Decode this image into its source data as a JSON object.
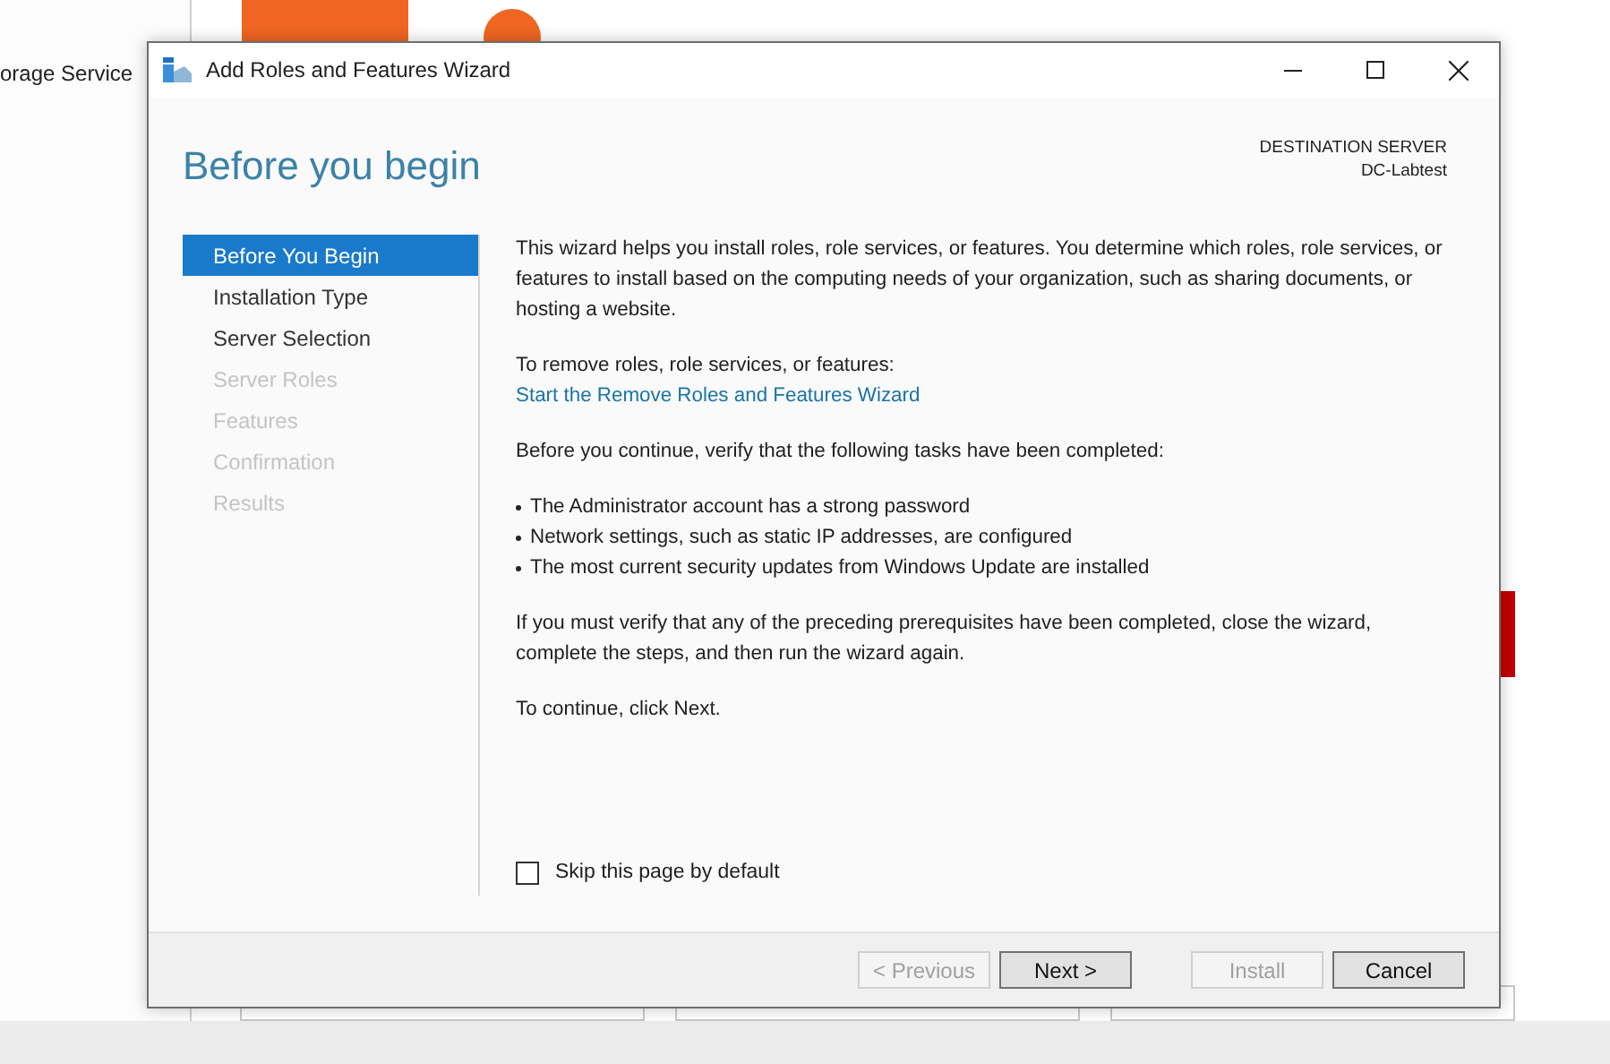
{
  "background": {
    "sidebar_item": "orage Service"
  },
  "window": {
    "title": "Add Roles and Features Wizard"
  },
  "header": {
    "title": "Before you begin",
    "destination_label": "DESTINATION SERVER",
    "destination_server": "DC-Labtest"
  },
  "steps": [
    {
      "label": "Before You Begin",
      "selected": true,
      "disabled": false
    },
    {
      "label": "Installation Type",
      "selected": false,
      "disabled": false
    },
    {
      "label": "Server Selection",
      "selected": false,
      "disabled": false
    },
    {
      "label": "Server Roles",
      "selected": false,
      "disabled": true
    },
    {
      "label": "Features",
      "selected": false,
      "disabled": true
    },
    {
      "label": "Confirmation",
      "selected": false,
      "disabled": true
    },
    {
      "label": "Results",
      "selected": false,
      "disabled": true
    }
  ],
  "content": [
    {
      "kind": "paragraph",
      "text": "This wizard helps you install roles, role services, or features. You determine which roles, role services, or features to install based on the computing needs of your organization, such as sharing documents, or hosting a website."
    },
    {
      "kind": "link_block",
      "text": "To remove roles, role services, or features:",
      "link": "Start the Remove Roles and Features Wizard"
    },
    {
      "kind": "paragraph",
      "text": "Before you continue, verify that the following tasks have been completed:"
    },
    {
      "kind": "bullets",
      "items": [
        "The Administrator account has a strong password",
        "Network settings, such as static IP addresses, are configured",
        "The most current security updates from Windows Update are installed"
      ]
    },
    {
      "kind": "paragraph",
      "text": "If you must verify that any of the preceding prerequisites have been completed, close the wizard, complete the steps, and then run the wizard again."
    },
    {
      "kind": "paragraph",
      "text": "To continue, click Next."
    }
  ],
  "skip_checkbox": {
    "label": "Skip this page by default",
    "checked": false
  },
  "nav_buttons": [
    {
      "label": "< Previous",
      "disabled": true
    },
    {
      "label": "Next >",
      "disabled": false
    }
  ],
  "action_buttons": [
    {
      "label": "Install",
      "disabled": true
    },
    {
      "label": "Cancel",
      "disabled": false
    }
  ]
}
